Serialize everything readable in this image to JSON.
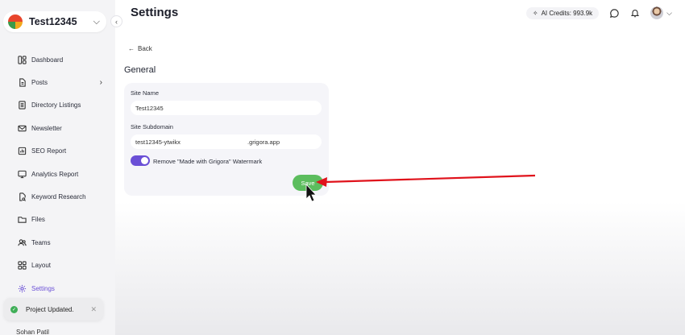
{
  "sidebar": {
    "workspace_name": "Test12345",
    "items": [
      {
        "label": "Dashboard",
        "icon": "dashboard-icon"
      },
      {
        "label": "Posts",
        "icon": "document-icon"
      },
      {
        "label": "Directory Listings",
        "icon": "list-icon"
      },
      {
        "label": "Newsletter",
        "icon": "mail-icon"
      },
      {
        "label": "SEO Report",
        "icon": "report-icon"
      },
      {
        "label": "Analytics Report",
        "icon": "monitor-icon"
      },
      {
        "label": "Keyword Research",
        "icon": "search-doc-icon"
      },
      {
        "label": "Files",
        "icon": "folder-icon"
      },
      {
        "label": "Teams",
        "icon": "users-icon"
      },
      {
        "label": "Layout",
        "icon": "grid-icon"
      },
      {
        "label": "Settings",
        "icon": "gear-icon",
        "active": true
      }
    ],
    "user_name": "Sohan Patil"
  },
  "toast": {
    "message": "Project Updated."
  },
  "header": {
    "title": "Settings",
    "ai_credits": "AI Credits: 993.9k"
  },
  "content": {
    "back_label": "Back",
    "section_title": "General",
    "site_name_label": "Site Name",
    "site_name_value": "Test12345",
    "subdomain_label": "Site Subdomain",
    "subdomain_value": "test12345-ytwikx",
    "subdomain_suffix": ".grigora.app",
    "watermark_label": "Remove \"Made with Grigora\" Watermark",
    "watermark_enabled": true,
    "save_label": "Save"
  },
  "colors": {
    "accent": "#6a4fd6",
    "save_green": "#5cbd5e",
    "annotation_arrow": "#e0121b"
  }
}
